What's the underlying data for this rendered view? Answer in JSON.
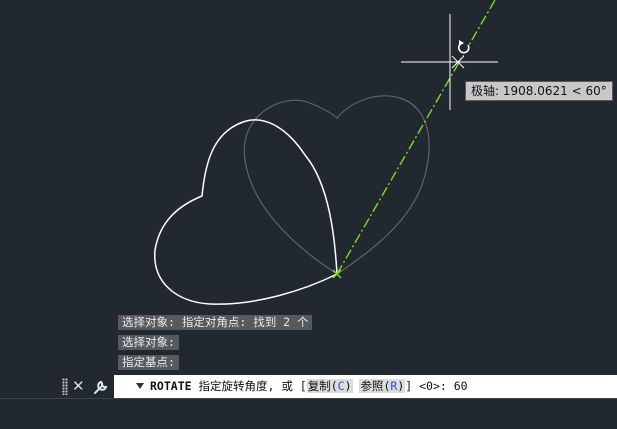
{
  "tooltip": {
    "label": "极轴:",
    "value": "1908.0621 < 60°"
  },
  "history": [
    "选择对象: 指定对角点: 找到 2 个",
    "选择对象:",
    "指定基点:"
  ],
  "command": {
    "name": "ROTATE",
    "prompt": "指定旋转角度, 或 [",
    "option1_label": "复制",
    "option1_key": "C",
    "option2_label": "参照",
    "option2_key": "R",
    "suffix": "] <0>: ",
    "value": "60"
  },
  "colors": {
    "background": "#212830",
    "original_shape": "#5c636b",
    "rotated_shape": "#ffffff",
    "rubberband": "#7ee01a"
  },
  "icons": [
    "grip-icon",
    "close-icon",
    "wrench-icon",
    "rotate-cursor-icon",
    "crosshair-icon"
  ]
}
